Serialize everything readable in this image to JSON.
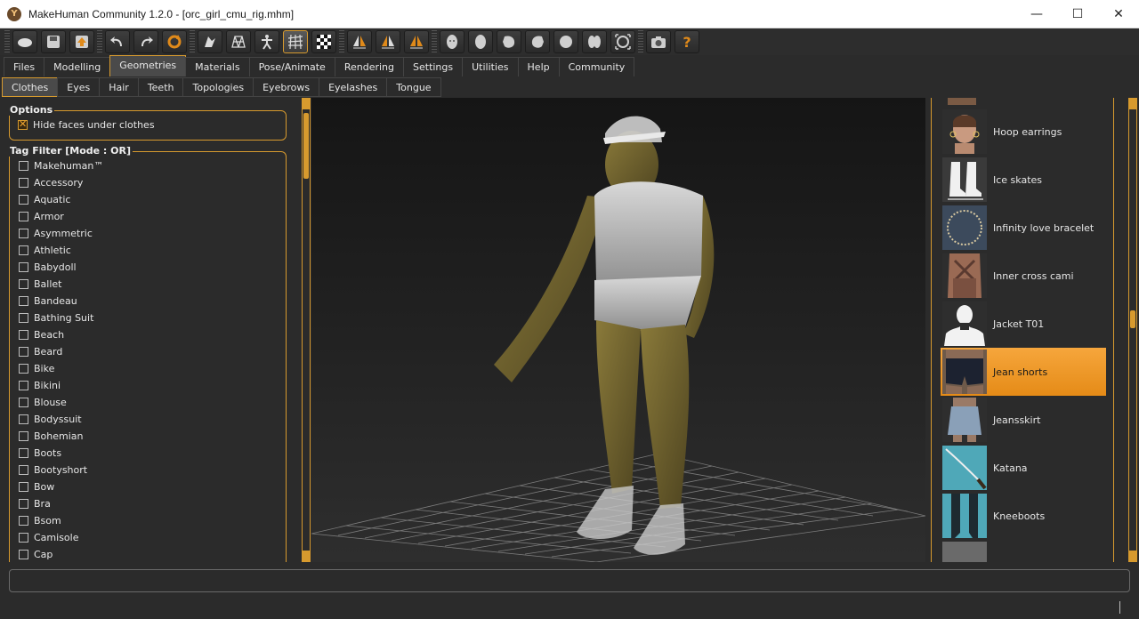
{
  "window": {
    "title": "MakeHuman Community 1.2.0 - [orc_girl_cmu_rig.mhm]",
    "minimize": "—",
    "maximize": "☐",
    "close": "✕"
  },
  "toolbar": {
    "icons": [
      "new-icon",
      "save-icon",
      "export-icon",
      "undo-icon",
      "redo-icon",
      "reset-icon",
      "smooth-icon",
      "wireframe-icon",
      "pose-icon",
      "grid-icon",
      "checker-icon",
      "symmetry-right-icon",
      "symmetry-left-icon",
      "symmetry-icon",
      "front-view-icon",
      "back-view-icon",
      "left-view-icon",
      "right-view-icon",
      "top-view-icon",
      "bottom-view-icon",
      "reset-camera-icon",
      "screenshot-icon",
      "help-icon"
    ]
  },
  "main_tabs": [
    {
      "label": "Files"
    },
    {
      "label": "Modelling"
    },
    {
      "label": "Geometries"
    },
    {
      "label": "Materials"
    },
    {
      "label": "Pose/Animate"
    },
    {
      "label": "Rendering"
    },
    {
      "label": "Settings"
    },
    {
      "label": "Utilities"
    },
    {
      "label": "Help"
    },
    {
      "label": "Community"
    }
  ],
  "sub_tabs": [
    {
      "label": "Clothes"
    },
    {
      "label": "Eyes"
    },
    {
      "label": "Hair"
    },
    {
      "label": "Teeth"
    },
    {
      "label": "Topologies"
    },
    {
      "label": "Eyebrows"
    },
    {
      "label": "Eyelashes"
    },
    {
      "label": "Tongue"
    }
  ],
  "options": {
    "title": "Options",
    "hide_faces_label": "Hide faces under clothes",
    "hide_faces_checked": true
  },
  "tag_filter": {
    "title": "Tag Filter [Mode : OR]",
    "tags": [
      "Makehuman™",
      "Accessory",
      "Aquatic",
      "Armor",
      "Asymmetric",
      "Athletic",
      "Babydoll",
      "Ballet",
      "Bandeau",
      "Bathing Suit",
      "Beach",
      "Beard",
      "Bike",
      "Bikini",
      "Blouse",
      "Bodyssuit",
      "Bohemian",
      "Boots",
      "Bootyshort",
      "Bow",
      "Bra",
      "Bsom",
      "Camisole",
      "Cap"
    ]
  },
  "clothes_list": {
    "items": [
      {
        "label": "Hoop earrings",
        "icon": "hoop-earrings-thumb"
      },
      {
        "label": "Ice skates",
        "icon": "ice-skates-thumb"
      },
      {
        "label": "Infinity love bracelet",
        "icon": "bracelet-thumb"
      },
      {
        "label": "Inner cross cami",
        "icon": "cami-thumb"
      },
      {
        "label": "Jacket T01",
        "icon": "jacket-thumb"
      },
      {
        "label": "Jean shorts",
        "icon": "jean-shorts-thumb",
        "selected": true
      },
      {
        "label": "Jeansskirt",
        "icon": "jeansskirt-thumb"
      },
      {
        "label": "Katana",
        "icon": "katana-thumb"
      },
      {
        "label": "Kneeboots",
        "icon": "kneeboots-thumb"
      }
    ]
  },
  "colors": {
    "accent": "#d79a2e",
    "selected_item": "#f39b2c",
    "background": "#2b2b2b"
  }
}
